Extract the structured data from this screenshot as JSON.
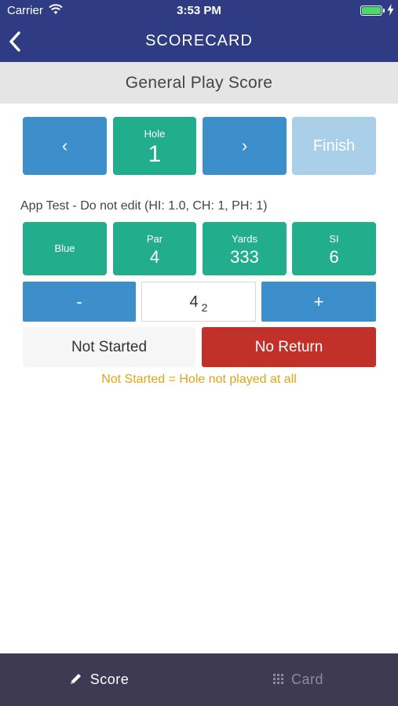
{
  "status_bar": {
    "carrier": "Carrier",
    "time": "3:53 PM"
  },
  "nav": {
    "title": "SCORECARD"
  },
  "section": {
    "title": "General Play Score"
  },
  "hole_nav": {
    "prev_label": "‹",
    "next_label": "›",
    "hole_label": "Hole",
    "hole_number": "1",
    "finish_label": "Finish"
  },
  "player": {
    "info": "App Test - Do not edit (HI: 1.0, CH: 1, PH: 1)"
  },
  "hole_info": {
    "tee": "Blue",
    "par_label": "Par",
    "par_value": "4",
    "yards_label": "Yards",
    "yards_value": "333",
    "si_label": "SI",
    "si_value": "6"
  },
  "stepper": {
    "minus_label": "-",
    "plus_label": "+",
    "score": "4",
    "points": "2"
  },
  "status_buttons": {
    "not_started": "Not Started",
    "no_return": "No Return"
  },
  "hint": "Not Started = Hole not played at all",
  "tabs": {
    "score": "Score",
    "card": "Card"
  },
  "colors": {
    "header_bg": "#2f3b82",
    "blue_button": "#3d8fcc",
    "green_tile": "#22ae8c",
    "finish_disabled": "#aacfe9",
    "no_return_red": "#c2302a",
    "hint_yellow": "#e2a417",
    "tabbar_bg": "#3e3a53"
  }
}
